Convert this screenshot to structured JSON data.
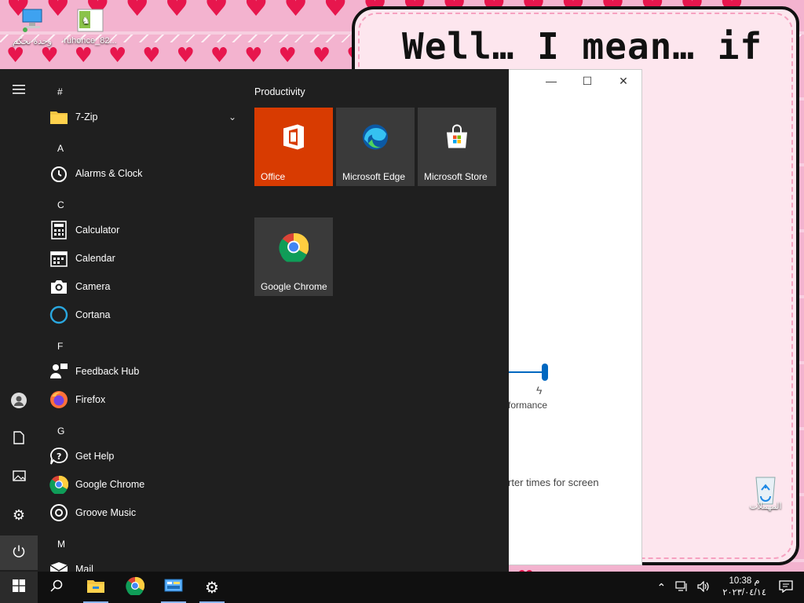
{
  "desktop": {
    "icons": [
      {
        "label": "وحدة تحكم",
        "icon": "network-computer-icon"
      },
      {
        "label": "ruhonce_82...",
        "icon": "image-file-icon"
      },
      {
        "label": "المهملات",
        "icon": "recycle-bin-icon"
      }
    ],
    "note_text": "Well… I mean… if\n...ut it..."
  },
  "background_window": {
    "controls": [
      "—",
      "☐",
      "✕"
    ],
    "slider_caption": "formance",
    "hint_text": "rter times for screen",
    "accent": "#0067c0"
  },
  "start_menu": {
    "rail": [
      {
        "name": "hamburger-menu-icon",
        "glyph": "☰"
      },
      {
        "name": "user-account-icon",
        "glyph": "👤"
      },
      {
        "name": "documents-icon",
        "glyph": "🗋"
      },
      {
        "name": "pictures-icon",
        "glyph": "🖼"
      },
      {
        "name": "settings-gear-icon",
        "glyph": "⚙"
      },
      {
        "name": "power-icon",
        "glyph": "⏻"
      }
    ],
    "app_list": [
      {
        "type": "letter",
        "text": "#"
      },
      {
        "type": "app",
        "label": "7-Zip",
        "icon": "folder-icon",
        "expandable": true
      },
      {
        "type": "letter",
        "text": "A"
      },
      {
        "type": "app",
        "label": "Alarms & Clock",
        "icon": "alarm-clock-icon"
      },
      {
        "type": "letter",
        "text": "C"
      },
      {
        "type": "app",
        "label": "Calculator",
        "icon": "calculator-icon"
      },
      {
        "type": "app",
        "label": "Calendar",
        "icon": "calendar-icon"
      },
      {
        "type": "app",
        "label": "Camera",
        "icon": "camera-icon"
      },
      {
        "type": "app",
        "label": "Cortana",
        "icon": "cortana-icon"
      },
      {
        "type": "letter",
        "text": "F"
      },
      {
        "type": "app",
        "label": "Feedback Hub",
        "icon": "feedback-hub-icon"
      },
      {
        "type": "app",
        "label": "Firefox",
        "icon": "firefox-icon"
      },
      {
        "type": "letter",
        "text": "G"
      },
      {
        "type": "app",
        "label": "Get Help",
        "icon": "get-help-icon"
      },
      {
        "type": "app",
        "label": "Google Chrome",
        "icon": "chrome-icon"
      },
      {
        "type": "app",
        "label": "Groove Music",
        "icon": "groove-music-icon"
      },
      {
        "type": "letter",
        "text": "M"
      },
      {
        "type": "app",
        "label": "Mail",
        "icon": "mail-icon"
      }
    ],
    "tile_group": "Productivity",
    "tiles": [
      {
        "label": "Office",
        "icon": "office-icon",
        "bg": "#d83b01"
      },
      {
        "label": "Microsoft Edge",
        "icon": "edge-icon",
        "bg": "#3a3a3a"
      },
      {
        "label": "Microsoft Store",
        "icon": "store-icon",
        "bg": "#3a3a3a"
      },
      {
        "label": "Google Chrome",
        "icon": "chrome-icon",
        "bg": "#3a3a3a"
      }
    ]
  },
  "taskbar": {
    "pinned": [
      {
        "name": "windows-start-icon"
      },
      {
        "name": "search-icon"
      },
      {
        "name": "file-explorer-icon"
      },
      {
        "name": "chrome-icon"
      },
      {
        "name": "control-panel-icon"
      },
      {
        "name": "settings-gear-icon"
      }
    ],
    "clock_time": "10:38 م",
    "clock_date": "٢٠٢٣/٠٤/١٤",
    "tray_icons": [
      "chevron-up-icon",
      "network-icon",
      "volume-icon",
      "notifications-icon"
    ]
  }
}
